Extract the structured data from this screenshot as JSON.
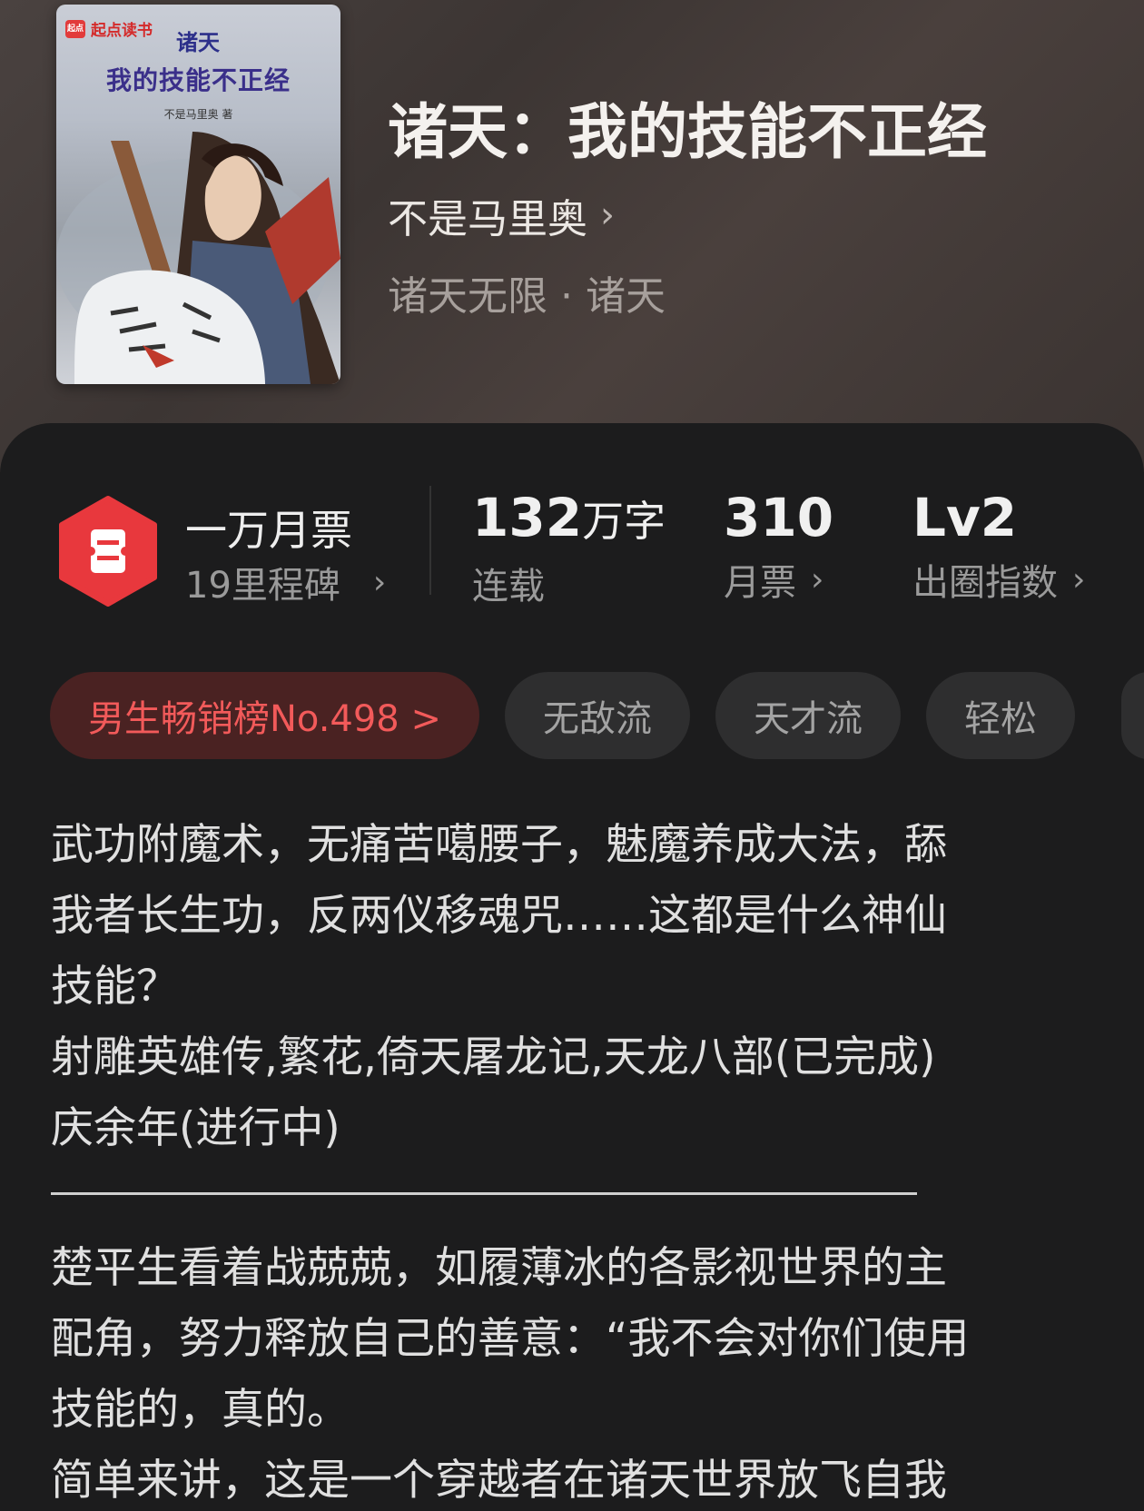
{
  "book": {
    "title": "诸天：我的技能不正经",
    "author": "不是马里奥",
    "category": "诸天无限 · 诸天"
  },
  "cover": {
    "brand": "起点读书",
    "line1": "诸天",
    "line2": "我的技能不正经",
    "author": "不是马里奥 著"
  },
  "stats": {
    "honor_title": "一万月票",
    "honor_sub": "19里程碑",
    "words_value": "132",
    "words_unit": "万字",
    "words_label": "连载",
    "tickets_value": "310",
    "tickets_label": "月票",
    "circle_value": "Lv2",
    "circle_label": "出圈指数"
  },
  "tags": {
    "rank": "男生畅销榜No.498 >",
    "items": [
      "无敌流",
      "天才流",
      "轻松"
    ]
  },
  "description": {
    "lines": [
      "武功附魔术，无痛苦噶腰子，魅魔养成大法，舔",
      "我者长生功，反两仪移魂咒……这都是什么神仙",
      "技能？",
      "射雕英雄传,繁花,倚天屠龙记,天龙八部(已完成)",
      "庆余年(进行中)"
    ],
    "lines2": [
      "楚平生看着战兢兢，如履薄冰的各影视世界的主",
      "配角，努力释放自己的善意：“我不会对你们使用",
      "技能的，真的。",
      "简单来讲，这是一个穿越者在诸天世界放飞自我"
    ]
  },
  "colors": {
    "accent": "#e8383d",
    "rank_bg": "#4a2222",
    "rank_text": "#f25a5a",
    "panel_bg": "#1c1c1d"
  }
}
